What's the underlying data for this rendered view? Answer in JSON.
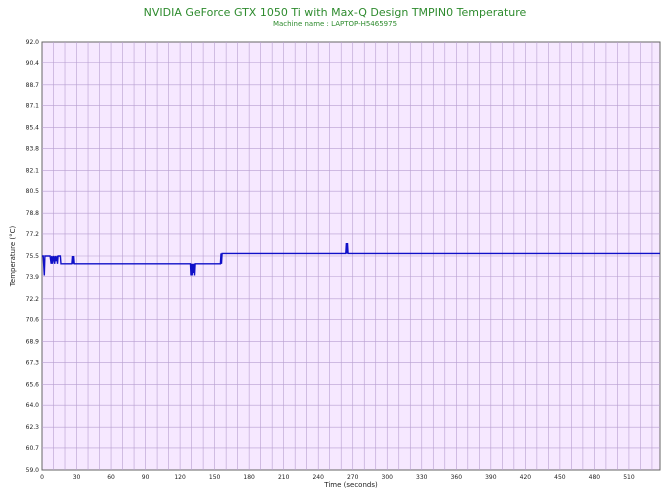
{
  "chart_data": {
    "type": "line",
    "title": "NVIDIA GeForce GTX 1050 Ti with Max-Q Design TMPIN0 Temperature",
    "subtitle": "Machine name : LAPTOP-H5465975",
    "xlabel": "Time (seconds)",
    "ylabel": "Temperature (°C)",
    "xlim": [
      0,
      537
    ],
    "ylim": [
      59.0,
      92.0
    ],
    "grid": true,
    "x_ticks": [
      0,
      30,
      60,
      90,
      120,
      150,
      180,
      210,
      240,
      270,
      300,
      330,
      360,
      390,
      420,
      450,
      480,
      510
    ],
    "y_ticks": [
      "59.0",
      "60.7",
      "62.3",
      "64.0",
      "65.6",
      "67.3",
      "68.9",
      "70.6",
      "72.2",
      "73.9",
      "75.5",
      "77.2",
      "78.8",
      "80.5",
      "82.1",
      "83.8",
      "85.4",
      "87.1",
      "88.7",
      "90.4",
      "92.0"
    ],
    "series": [
      {
        "values_x": [
          0,
          1,
          2,
          2.5,
          3,
          4,
          6,
          7,
          8,
          8.5,
          9,
          10,
          11,
          11.5,
          12,
          13,
          13.5,
          14,
          15,
          16,
          16.5,
          17,
          18,
          26,
          26.5,
          27,
          27.5,
          28,
          29,
          30,
          60,
          90,
          120,
          129,
          129.5,
          130,
          130.5,
          131,
          131.5,
          132,
          132.5,
          133,
          134,
          150,
          154,
          155,
          155.5,
          156,
          156.5,
          157,
          160,
          200,
          264,
          264.5,
          265,
          265.5,
          266,
          300,
          400,
          500,
          537
        ],
        "values_y": [
          75.5,
          75.5,
          74.0,
          75.5,
          75.5,
          75.5,
          75.5,
          75.5,
          74.9,
          75.5,
          74.9,
          75.5,
          74.9,
          75.5,
          75.1,
          75.5,
          74.9,
          75.5,
          75.5,
          75.5,
          74.9,
          74.9,
          74.9,
          74.9,
          75.5,
          74.9,
          75.5,
          74.9,
          74.9,
          74.9,
          74.9,
          74.9,
          74.9,
          74.9,
          74.0,
          74.9,
          74.0,
          74.9,
          74.2,
          74.9,
          74.0,
          74.9,
          74.9,
          74.9,
          74.9,
          74.9,
          75.7,
          74.9,
          75.7,
          75.7,
          75.7,
          75.7,
          75.7,
          76.5,
          75.7,
          76.5,
          75.7,
          75.7,
          75.7,
          75.7,
          75.7
        ],
        "color": "#1010c8"
      }
    ],
    "colors": {
      "plot_bg": "#f6e8ff",
      "grid": "#b79ed0",
      "title": "#2e8b2e"
    }
  }
}
